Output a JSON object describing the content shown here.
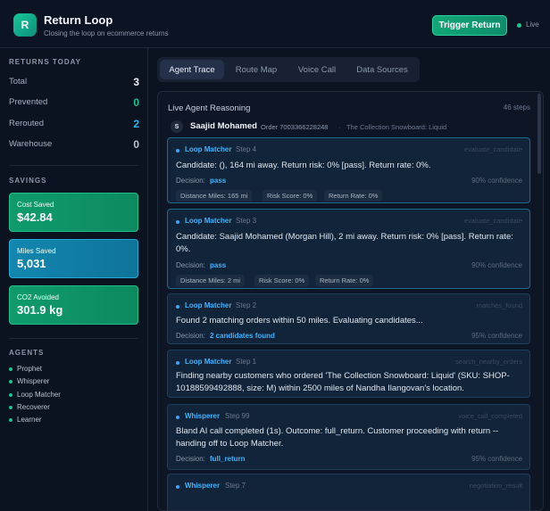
{
  "app": {
    "logo_letter": "R",
    "title": "Return Loop",
    "subtitle": "Closing the loop on ecommerce returns",
    "trigger_label": "Trigger Return",
    "live_label": "Live"
  },
  "sidebar": {
    "returns_title": "RETURNS TODAY",
    "stats": [
      {
        "label": "Total",
        "value": "3",
        "color": "#e6edf5"
      },
      {
        "label": "Prevented",
        "value": "0",
        "color": "#19c58f"
      },
      {
        "label": "Rerouted",
        "value": "2",
        "color": "#2fb4e8"
      },
      {
        "label": "Warehouse",
        "value": "0",
        "color": "#b7c1cf"
      }
    ],
    "savings_title": "SAVINGS",
    "savings": [
      {
        "label": "Cost Saved",
        "value": "$42.84",
        "color": "#0f9b6c"
      },
      {
        "label": "Miles Saved",
        "value": "5,031",
        "color": "#1287b0"
      },
      {
        "label": "CO2 Avoided",
        "value": "301.9 kg",
        "color": "#0f9b6c"
      }
    ],
    "agents_title": "AGENTS",
    "agents": [
      "Prophet",
      "Whisperer",
      "Loop Matcher",
      "Recoverer",
      "Learner"
    ]
  },
  "tabs": [
    "Agent Trace",
    "Route Map",
    "Voice Call",
    "Data Sources"
  ],
  "panel": {
    "title": "Live Agent Reasoning",
    "steps_count": "46 steps",
    "customer": {
      "avatar_letter": "S",
      "name": "Saajid Mohamed",
      "order": "Order 7003366228248",
      "separator": "·",
      "product": "The Collection Snowboard: Liquid"
    },
    "steps": [
      {
        "agent": "Loop Matcher",
        "step": "Step 4",
        "action": "evaluate_candidate",
        "text": "Candidate: (), 164 mi away. Return risk: 0% [pass]. Return rate: 0%.",
        "decision_label": "Decision:",
        "decision": "pass",
        "confidence": "90% confidence",
        "chips": [
          "Distance Miles: 165 mi",
          "Risk Score: 0%",
          "Return Rate: 0%"
        ]
      },
      {
        "agent": "Loop Matcher",
        "step": "Step 3",
        "action": "evaluate_candidate",
        "text": "Candidate: Saajid Mohamed (Morgan Hill), 2 mi away. Return risk: 0% [pass]. Return rate: 0%.",
        "decision_label": "Decision:",
        "decision": "pass",
        "confidence": "90% confidence",
        "chips": [
          "Distance Miles: 2 mi",
          "Risk Score: 0%",
          "Return Rate: 0%"
        ]
      },
      {
        "agent": "Loop Matcher",
        "step": "Step 2",
        "action": "matches_found",
        "text": "Found 2 matching orders within 50 miles. Evaluating candidates...",
        "decision_label": "Decision:",
        "decision": "2 candidates found",
        "confidence": "95% confidence",
        "chips": []
      },
      {
        "agent": "Loop Matcher",
        "step": "Step 1",
        "action": "search_nearby_orders",
        "text": "Finding nearby customers who ordered 'The Collection Snowboard: Liquid' (SKU: SHOP-10188599492888, size: M) within 2500 miles of Nandha Ilangovan's location.",
        "decision_label": "",
        "decision": "",
        "confidence": "",
        "chips": []
      },
      {
        "agent": "Whisperer",
        "step": "Step 99",
        "action": "voice_call_completed",
        "text": "Bland AI call completed (1s). Outcome: full_return. Customer proceeding with return -- handing off to Loop Matcher.",
        "decision_label": "Decision:",
        "decision": "full_return",
        "confidence": "95% confidence",
        "chips": []
      },
      {
        "agent": "Whisperer",
        "step": "Step 7",
        "action": "negotiation_result",
        "text": "",
        "decision_label": "",
        "decision": "",
        "confidence": "",
        "chips": []
      }
    ]
  }
}
